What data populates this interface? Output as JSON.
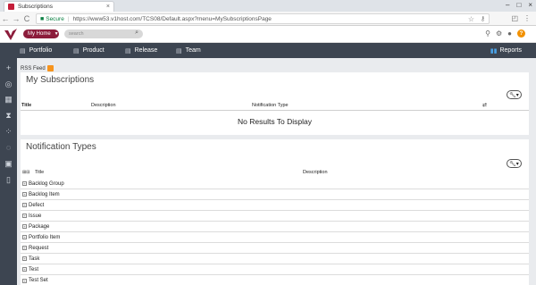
{
  "browser": {
    "tab_title": "Subscriptions",
    "tab_close": "×",
    "window_controls": [
      "–",
      "□",
      "×"
    ],
    "nav": {
      "back": "←",
      "forward": "→",
      "reload": "C"
    },
    "secure_label": "Secure",
    "url": "https://www53.v1host.com/TCS08/Default.aspx?menu=MySubscriptionsPage",
    "star": "☆",
    "key_icon": "⚷"
  },
  "app": {
    "my_home_label": "My Home",
    "search_placeholder": "search",
    "nav": [
      {
        "label": "Portfolio"
      },
      {
        "label": "Product"
      },
      {
        "label": "Release"
      },
      {
        "label": "Team"
      }
    ],
    "reports_label": "Reports",
    "help_label": "?"
  },
  "rss_label": "RSS Feed",
  "subscriptions": {
    "title": "My Subscriptions",
    "columns": [
      "Title",
      "Description",
      "Notification Type"
    ],
    "empty_text": "No Results To Display"
  },
  "notification_types": {
    "title": "Notification Types",
    "columns": [
      "Title",
      "Description"
    ],
    "rows": [
      "Backlog Group",
      "Backlog Item",
      "Defect",
      "Issue",
      "Package",
      "Portfolio Item",
      "Request",
      "Task",
      "Test",
      "Test Set"
    ]
  },
  "colors": {
    "accent_maroon": "#8c1c3b",
    "navbar": "#3d4551",
    "help_orange": "#f29100",
    "rss_orange": "#f7941d"
  }
}
